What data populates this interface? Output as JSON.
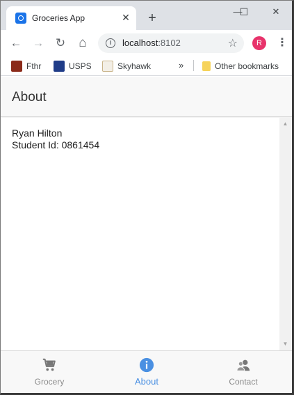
{
  "browser": {
    "tab_title": "Groceries App",
    "close_glyph": "✕",
    "newtab_glyph": "+",
    "window_controls": {
      "minimize": "—",
      "maximize": "☐",
      "close": "✕"
    },
    "nav": {
      "back": "←",
      "forward": "→",
      "reload": "↻",
      "home": "⌂"
    },
    "url_host": "localhost",
    "url_port": ":8102",
    "info_glyph": "i",
    "star_glyph": "☆",
    "avatar_letter": "R",
    "menu_glyph": "⋮",
    "bookmarks": [
      {
        "label": "Fthr",
        "icon": "fthr-favicon"
      },
      {
        "label": "USPS",
        "icon": "usps-favicon"
      },
      {
        "label": "Skyhawk",
        "icon": "skyhawk-favicon"
      }
    ],
    "bookmarks_more": "»",
    "other_bookmarks": "Other bookmarks"
  },
  "app": {
    "header_title": "About",
    "content_lines": [
      "Ryan Hilton",
      "Student Id: 0861454"
    ],
    "scroll_up": "▲",
    "scroll_down": "▼",
    "tabs": [
      {
        "label": "Grocery",
        "icon": "cart-icon",
        "active": false
      },
      {
        "label": "About",
        "icon": "info-icon",
        "active": true
      },
      {
        "label": "Contact",
        "icon": "contacts-icon",
        "active": false
      }
    ]
  },
  "colors": {
    "accent": "#4a90e2",
    "inactive_tab": "#8c8c8c",
    "avatar_bg": "#e8336b",
    "tabstrip_bg": "#dee1e6"
  }
}
